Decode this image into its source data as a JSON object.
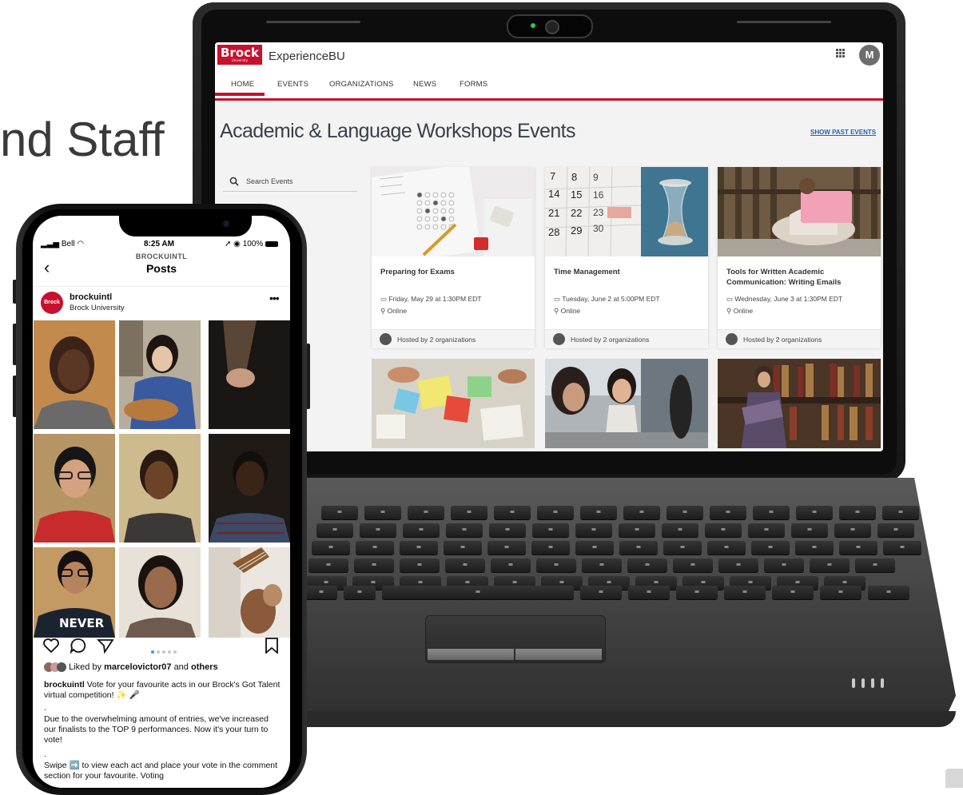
{
  "slide": {
    "title_fragment": "nd Staff"
  },
  "laptop": {
    "app": {
      "logo": "Brock",
      "logo_sub": "University",
      "name": "ExperienceBU",
      "avatar_initial": "M"
    },
    "nav": {
      "items": [
        "HOME",
        "EVENTS",
        "ORGANIZATIONS",
        "NEWS",
        "FORMS"
      ],
      "active": "HOME"
    },
    "page": {
      "title": "Academic & Language Workshops Events",
      "past_events_link": "SHOW PAST EVENTS"
    },
    "search": {
      "placeholder": "Search Events"
    },
    "events": [
      {
        "title": "Preparing for Exams",
        "date": "Friday, May 29 at 1:30PM EDT",
        "location": "Online",
        "hosted": "Hosted by 2 organizations"
      },
      {
        "title": "Time Management",
        "date": "Tuesday, June 2 at 5:00PM EDT",
        "location": "Online",
        "hosted": "Hosted by 2 organizations"
      },
      {
        "title": "Tools for Written Academic Communication: Writing Emails",
        "date": "Wednesday, June 3 at 1:30PM EDT",
        "location": "Online",
        "hosted": "Hosted by 2 organizations"
      }
    ],
    "calendar_numbers": [
      "7",
      "8",
      "9",
      "14",
      "15",
      "16",
      "21",
      "22",
      "23",
      "28",
      "29",
      "30"
    ]
  },
  "phone": {
    "status": {
      "carrier": "Bell",
      "time": "8:25 AM",
      "battery": "100%"
    },
    "header": {
      "account": "BROCKUINTL",
      "title": "Posts"
    },
    "post": {
      "avatar_label": "Brock",
      "username": "brockuintl",
      "subtitle": "Brock University",
      "tile_text": "NEVER",
      "likes_prefix": "Liked by",
      "likes_user": "marcelovictor07",
      "likes_suffix": "and",
      "likes_others": "others",
      "caption_user": "brockuintl",
      "caption_1": "Vote for your favourite acts in our Brock's Got Talent virtual competition! ✨ 🎤",
      "caption_dot": ".",
      "caption_2": "Due to the overwhelming amount of entries, we've increased our finalists to the TOP 9 performances. Now it's your turn to vote!",
      "caption_dot2": ".",
      "caption_3": "Swipe ➡️ to view each act and place your vote in the comment section for your favourite. Voting"
    }
  },
  "colors": {
    "brand_red": "#c8102e",
    "link_blue": "#1e64b4",
    "laptop_body": "#2b2b2b"
  }
}
